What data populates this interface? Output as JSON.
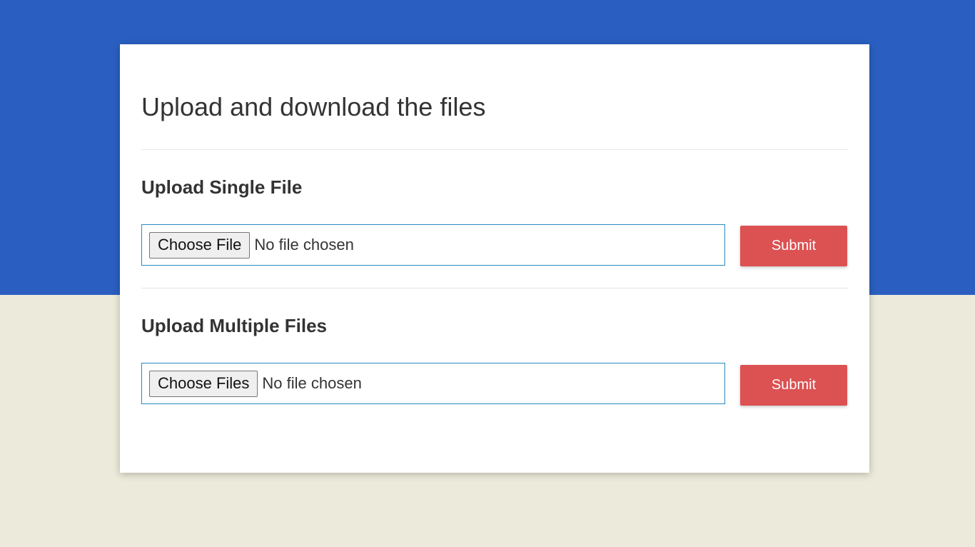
{
  "page": {
    "title": "Upload and download the files"
  },
  "single_upload": {
    "heading": "Upload Single File",
    "choose_label": "Choose File",
    "status": "No file chosen",
    "submit_label": "Submit"
  },
  "multiple_upload": {
    "heading": "Upload Multiple Files",
    "choose_label": "Choose Files",
    "status": "No file chosen",
    "submit_label": "Submit"
  },
  "colors": {
    "top_background": "#2a5fc1",
    "bottom_background": "#eceada",
    "submit_button": "#dc5152",
    "field_border": "#2a8bc1"
  }
}
